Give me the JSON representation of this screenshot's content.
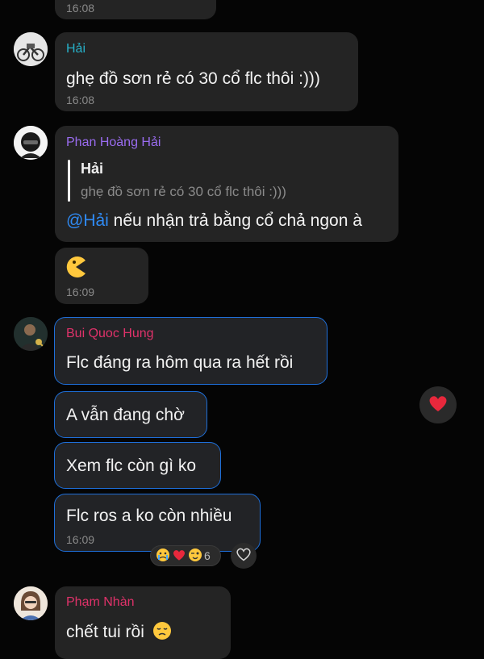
{
  "messages": {
    "top_time": "16:08",
    "m1": {
      "sender": "Hải",
      "sender_color": "#27b0c8",
      "text": "ghẹ đồ sơn rẻ có 30 cổ flc thôi :)))",
      "time": "16:08"
    },
    "m2": {
      "sender": "Phan Hoàng Hải",
      "sender_color": "#9a6cf0",
      "quote_name": "Hải",
      "quote_text": "ghẹ đồ sơn rẻ có 30 cổ flc thôi :)))",
      "mention": "@Hải",
      "text": " nếu nhận trả bằng cổ chả ngon à"
    },
    "m3": {
      "emoji": "pacman-face",
      "time": "16:09"
    },
    "m4": {
      "sender": "Bui Quoc Hung",
      "sender_color": "#e0326a",
      "text": "Flc đáng ra hôm qua ra hết rồi"
    },
    "m5": {
      "text": "A vẫn đang chờ"
    },
    "m6": {
      "text": "Xem flc còn gì ko"
    },
    "m7": {
      "text": "Flc ros a ko còn nhiều",
      "time": "16:09",
      "reaction_count": "6"
    },
    "m8": {
      "sender": "Phạm Nhàn",
      "sender_color": "#e0326a",
      "text": "chết tui rồi"
    }
  },
  "icons": {
    "heart": "heart-reaction-icon",
    "reaction_add": "heart-outline-icon"
  }
}
